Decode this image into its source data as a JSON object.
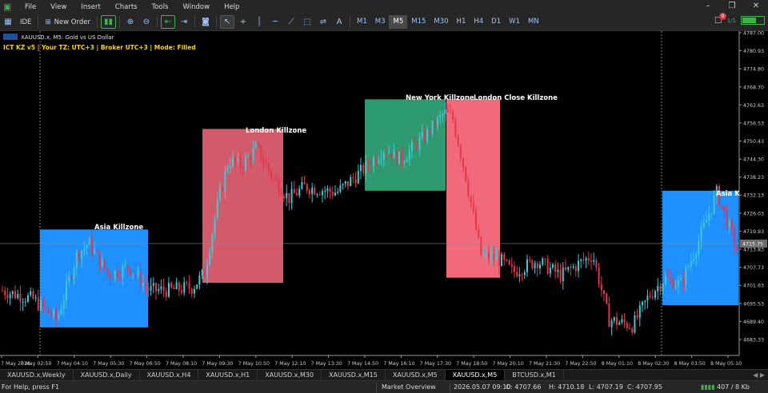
{
  "menu": [
    "File",
    "View",
    "Insert",
    "Charts",
    "Tools",
    "Window",
    "Help"
  ],
  "toolbar": {
    "ide_label": "IDE",
    "new_order_label": "New Order",
    "timeframes": [
      "M1",
      "M3",
      "M5",
      "M15",
      "M30",
      "H1",
      "H4",
      "D1",
      "W1",
      "MN"
    ],
    "active_timeframe": "M5",
    "notification_count": "9",
    "signal_label": "1/1"
  },
  "chart": {
    "header": "XAUUSD.x, M5:  Gold vs US Dollar",
    "indicator": "ICT KZ v5 | Your TZ: UTC+3 | Broker UTC+3 | Mode: Filled",
    "price_labels": [
      "4787.00",
      "4780.93",
      "4774.80",
      "4768.70",
      "4762.63",
      "4756.53",
      "4750.43",
      "4744.30",
      "4738.23",
      "4732.13",
      "4726.03",
      "4719.93",
      "4713.83",
      "4707.73",
      "4701.63",
      "4695.53",
      "4689.40",
      "4683.33"
    ],
    "current_price": "4715.75",
    "time_labels": [
      "7 May 2026",
      "7 May 02:50",
      "7 May 04:10",
      "7 May 05:30",
      "7 May 06:50",
      "7 May 08:10",
      "7 May 09:30",
      "7 May 10:50",
      "7 May 12:10",
      "7 May 13:30",
      "7 May 14:50",
      "7 May 16:10",
      "7 May 17:30",
      "7 May 18:50",
      "7 May 20:10",
      "7 May 21:30",
      "7 May 22:50",
      "8 May 01:10",
      "8 May 02:30",
      "8 May 03:50",
      "8 May 05:10"
    ],
    "killzones": [
      {
        "label": "Asia Killzone",
        "color": "#1e90ff",
        "from": 50,
        "to": 185,
        "high": 4720.5,
        "low": 4687.4
      },
      {
        "label": "London Killzone",
        "color": "#d35a6a",
        "from": 253,
        "to": 354,
        "high": 4754.5,
        "low": 4702.5
      },
      {
        "label": "New York Killzone",
        "color": "#2e9a70",
        "from": 456,
        "to": 557,
        "high": 4764.5,
        "low": 4733.6
      },
      {
        "label": "London Close Killzone",
        "color": "#f06a7c",
        "from": 558,
        "to": 625,
        "high": 4764.5,
        "low": 4704.2
      },
      {
        "label": "Asia Killzone",
        "color": "#1e90ff",
        "from": 828,
        "to": 923,
        "high": 4733.6,
        "low": 4694.9
      }
    ]
  },
  "tabs": [
    "XAUUSD.x,Weekly",
    "XAUUSD.x,Daily",
    "XAUUSD.x,H4",
    "XAUUSD.x,H1",
    "XAUUSD.x,M30",
    "XAUUSD.x,M15",
    "XAUUSD.x,M5",
    "XAUUSD.x,M5",
    "BTCUSD.x,M1"
  ],
  "active_tab": 7,
  "status": {
    "help": "For Help, press F1",
    "market": "Market Overview",
    "datetime": "2026.05.07 09:10",
    "open": "O: 4707.66",
    "high": "H: 4710.18",
    "low": "L: 4707.19",
    "close": "C: 4707.95",
    "traffic": "407 / 8 Kb"
  }
}
